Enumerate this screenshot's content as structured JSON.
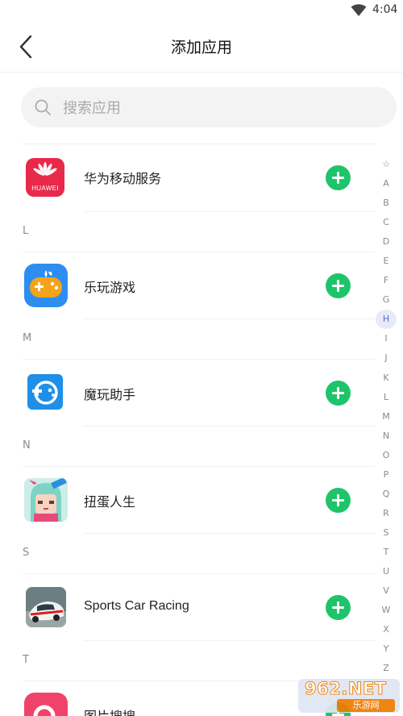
{
  "status_bar": {
    "time": "4:04"
  },
  "header": {
    "title": "添加应用"
  },
  "search": {
    "placeholder": "搜索应用"
  },
  "list": [
    {
      "type": "app",
      "name": "华为移动服务",
      "icon": "huawei-logo",
      "icon_text": "HUAWEI"
    },
    {
      "type": "section",
      "label": "L"
    },
    {
      "type": "app",
      "name": "乐玩游戏",
      "icon": "gamepad"
    },
    {
      "type": "section",
      "label": "M"
    },
    {
      "type": "app",
      "name": "魔玩助手",
      "icon": "mowan-face"
    },
    {
      "type": "section",
      "label": "N"
    },
    {
      "type": "app",
      "name": "扭蛋人生",
      "icon": "anime-girl"
    },
    {
      "type": "section",
      "label": "S"
    },
    {
      "type": "app",
      "name": "Sports Car Racing",
      "icon": "race-car"
    },
    {
      "type": "section",
      "label": "T"
    },
    {
      "type": "app",
      "name": "图片搜搜",
      "icon": "image-search"
    }
  ],
  "index_bar": {
    "letters": [
      "☆",
      "A",
      "B",
      "C",
      "D",
      "E",
      "F",
      "G",
      "H",
      "I",
      "J",
      "K",
      "L",
      "M",
      "N",
      "O",
      "P",
      "Q",
      "R",
      "S",
      "T",
      "U",
      "V",
      "W",
      "X",
      "Y",
      "Z"
    ],
    "active": "H"
  },
  "watermark": {
    "brand": "962.NET",
    "sub": "乐游网"
  },
  "colors": {
    "add_button": "#1ec46a",
    "index_active": "#5c6bc0",
    "huawei_red": "#e8294a"
  }
}
